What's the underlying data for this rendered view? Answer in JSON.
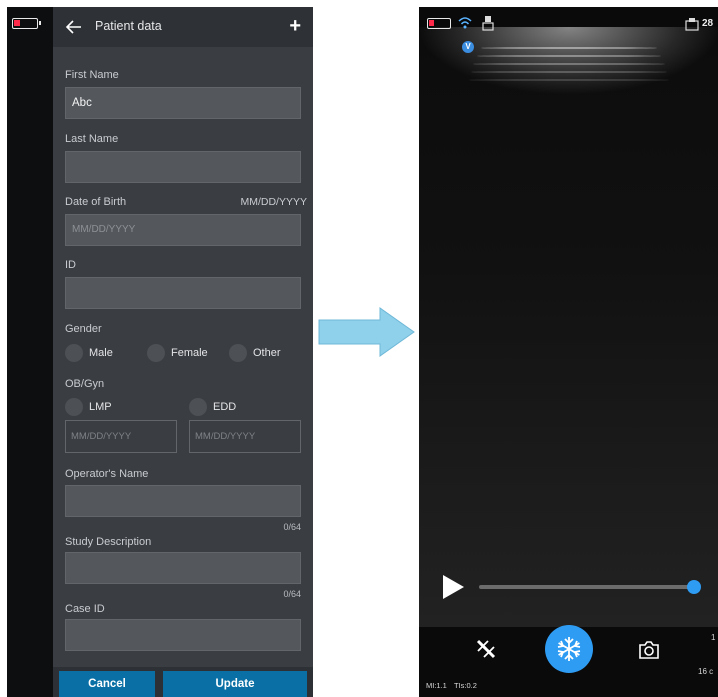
{
  "left_screen": {
    "header": {
      "title": "Patient data",
      "back_icon": "back-arrow-icon",
      "add_icon": "plus-icon",
      "add_symbol": "+"
    },
    "form": {
      "first_name": {
        "label": "First Name",
        "value": "Abc"
      },
      "last_name": {
        "label": "Last Name",
        "value": ""
      },
      "dob": {
        "label": "Date of Birth",
        "format_hint": "MM/DD/YYYY",
        "placeholder": "MM/DD/YYYY"
      },
      "id": {
        "label": "ID",
        "value": ""
      },
      "gender": {
        "label": "Gender",
        "options": [
          "Male",
          "Female",
          "Other"
        ]
      },
      "obgyn": {
        "label": "OB/Gyn",
        "options": [
          "LMP",
          "EDD"
        ],
        "lmp_placeholder": "MM/DD/YYYY",
        "edd_placeholder": "MM/DD/YYYY"
      },
      "operator_name": {
        "label": "Operator's Name",
        "value": "",
        "counter": "0/64"
      },
      "study_description": {
        "label": "Study Description",
        "value": "",
        "counter": "0/64"
      },
      "case_id": {
        "label": "Case ID",
        "value": ""
      }
    },
    "buttons": {
      "cancel": "Cancel",
      "update": "Update"
    },
    "colors": {
      "panel": "#3a3d42",
      "button": "#0a6fa4",
      "battery_low": "#ff2a4a"
    }
  },
  "arrow": {
    "color": "#8fd0ea"
  },
  "right_screen": {
    "status": {
      "badge": "V",
      "top_right_value": "28"
    },
    "controls": {
      "play_icon": "play-icon",
      "freeze_icon": "snowflake-icon",
      "measure_icon": "caliper-icon",
      "camera_icon": "camera-icon",
      "cine_progress": 1.0
    },
    "readouts": {
      "mi": "MI:1.1",
      "tis": "TIs:0.2",
      "depth": "16 c",
      "side_digit": "1"
    },
    "colors": {
      "accent": "#2f9cf4"
    }
  }
}
